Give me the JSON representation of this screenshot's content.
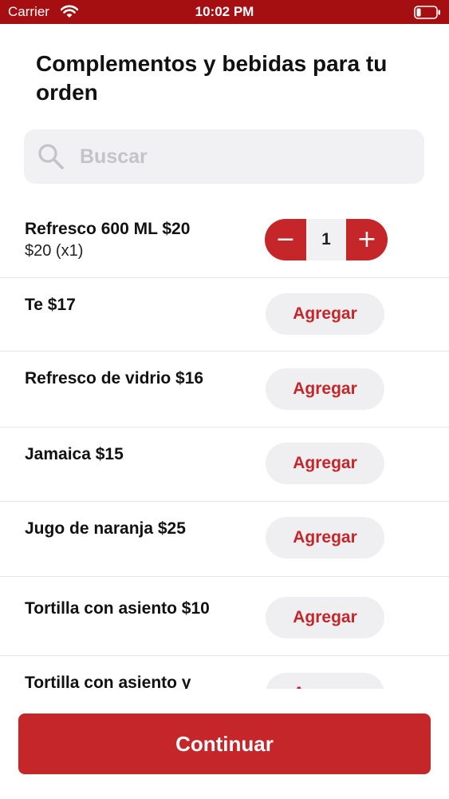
{
  "status_bar": {
    "carrier": "Carrier",
    "time": "10:02 PM"
  },
  "header": {
    "title": "Complementos y bebidas para tu orden"
  },
  "search": {
    "placeholder": "Buscar",
    "value": ""
  },
  "items": [
    {
      "name": "Refresco 600 ML  $20",
      "subtitle": "$20 (x1)",
      "quantity": "1",
      "minus_label": "−",
      "plus_label": "+"
    },
    {
      "name": "Te  $17",
      "button_label": "Agregar"
    },
    {
      "name": "Refresco de vidrio $16",
      "button_label": "Agregar"
    },
    {
      "name": "Jamaica  $15",
      "button_label": "Agregar"
    },
    {
      "name": "Jugo de naranja  $25",
      "button_label": "Agregar"
    },
    {
      "name": "Tortilla con asiento $10",
      "button_label": "Agregar"
    },
    {
      "name": "Tortilla con asiento y",
      "button_label": "Agregar"
    }
  ],
  "footer": {
    "continue_label": "Continuar"
  },
  "colors": {
    "accent": "#c4262a",
    "status_bar": "#a50f12",
    "chip_bg": "#efeff1"
  }
}
